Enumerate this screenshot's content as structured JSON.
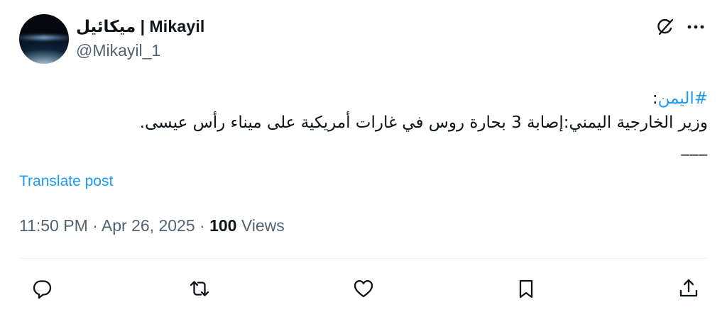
{
  "author": {
    "display_name": "ميكائيل | Mikayil",
    "handle": "@Mikayil_1"
  },
  "icons": {
    "grok": "grok-icon",
    "more": "more-icon"
  },
  "post": {
    "hashtag": "#اليمن",
    "hashtag_suffix": ":",
    "line2": "وزير الخارجية اليمني:إصابة 3 بحارة روس في غارات أمريكية على ميناء رأس عيسى.",
    "line3": "___"
  },
  "translate_label": "Translate post",
  "meta": {
    "time": "11:50 PM",
    "separator1": " · ",
    "date": "Apr 26, 2025",
    "separator2": " · ",
    "views_count": "100",
    "views_label": " Views"
  },
  "actions": [
    {
      "name": "reply",
      "icon": "reply-icon"
    },
    {
      "name": "repost",
      "icon": "repost-icon"
    },
    {
      "name": "like",
      "icon": "heart-icon"
    },
    {
      "name": "bookmark",
      "icon": "bookmark-icon"
    },
    {
      "name": "share",
      "icon": "share-icon"
    }
  ],
  "colors": {
    "accent": "#1d9bf0",
    "text": "#0f1419",
    "secondary": "#536471",
    "divider": "#eff3f4"
  }
}
